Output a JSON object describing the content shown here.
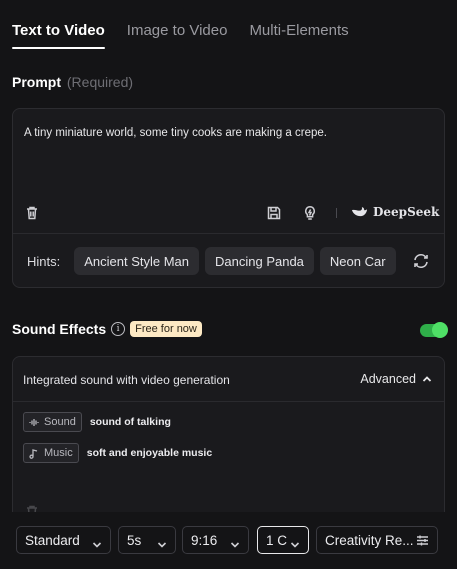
{
  "tabs": [
    {
      "label": "Text to Video",
      "active": true
    },
    {
      "label": "Image to Video",
      "active": false
    },
    {
      "label": "Multi-Elements",
      "active": false
    }
  ],
  "prompt": {
    "title": "Prompt",
    "required": "(Required)",
    "text": "A tiny miniature world, some tiny cooks are making a crepe.",
    "deepseek_label": "DeepSeek"
  },
  "hints": {
    "label": "Hints:",
    "items": [
      "Ancient Style Man",
      "Dancing Panda",
      "Neon Car"
    ]
  },
  "sound_effects": {
    "title": "Sound Effects",
    "badge": "Free for now",
    "enabled": true,
    "card_title": "Integrated sound with video generation",
    "advanced_label": "Advanced",
    "rows": [
      {
        "tag": "Sound",
        "icon": "waveform-icon",
        "description": "sound of talking"
      },
      {
        "tag": "Music",
        "icon": "music-note-icon",
        "description": "soft and enjoyable music"
      }
    ]
  },
  "bottom_bar": {
    "quality": "Standard",
    "duration": "5s",
    "aspect_ratio": "9:16",
    "count": "1 C",
    "creativity": "Creativity Re..."
  },
  "colors": {
    "background": "#141416",
    "toggle_on": "#4fe066",
    "badge_bg": "#fde9c4"
  }
}
